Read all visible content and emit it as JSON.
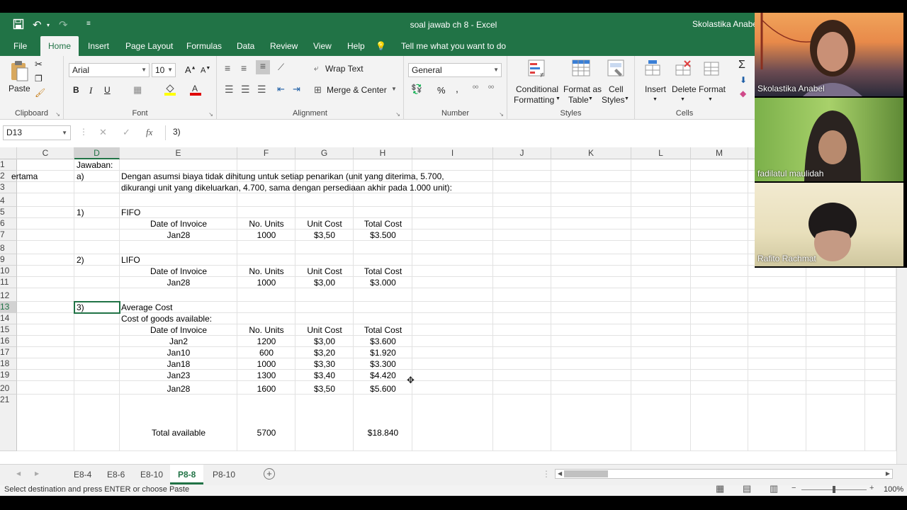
{
  "window": {
    "title": "soal jawab ch 8  -  Excel",
    "account": "Skolastika Anabel"
  },
  "ribbon_tabs": [
    "File",
    "Home",
    "Insert",
    "Page Layout",
    "Formulas",
    "Data",
    "Review",
    "View",
    "Help",
    "Tell me what you want to do"
  ],
  "ribbon": {
    "clipboard": {
      "label": "Clipboard",
      "paste": "Paste"
    },
    "font": {
      "label": "Font",
      "name": "Arial",
      "size": "10",
      "bold": "B",
      "italic": "I",
      "underline": "U"
    },
    "alignment": {
      "label": "Alignment",
      "wrap": "Wrap Text",
      "merge": "Merge & Center"
    },
    "number": {
      "label": "Number",
      "format": "General",
      "percent": "%",
      "comma": ","
    },
    "styles": {
      "label": "Styles",
      "conditional": "Conditional",
      "conditional2": "Formatting",
      "format_as": "Format as",
      "format_as2": "Table",
      "cell": "Cell",
      "cell2": "Styles"
    },
    "cells": {
      "label": "Cells",
      "insert": "Insert",
      "delete": "Delete",
      "format": "Format"
    }
  },
  "formula_bar": {
    "name_box": "D13",
    "content": "3)"
  },
  "columns": [
    "C",
    "D",
    "E",
    "F",
    "G",
    "H",
    "I",
    "J",
    "K",
    "L",
    "M"
  ],
  "rows": [
    {
      "n": "1",
      "D": "Jawaban:"
    },
    {
      "n": "2",
      "C": "ertama",
      "D": "a)",
      "E": "Dengan asumsi biaya tidak dihitung untuk setiap penarikan (unit yang diterima, 5.700,"
    },
    {
      "n": "3",
      "E": "dikurangi unit yang dikeluarkan, 4.700, sama dengan persediaan akhir pada 1.000 unit):"
    },
    {
      "n": "4"
    },
    {
      "n": "5",
      "D": "1)",
      "E": "FIFO"
    },
    {
      "n": "6",
      "Ec": "Date of Invoice",
      "F": "No. Units",
      "G": "Unit Cost",
      "H": "Total Cost"
    },
    {
      "n": "7",
      "Ec": "Jan28",
      "F": "1000",
      "G": "$3,50",
      "H": "$3.500"
    },
    {
      "n": "8"
    },
    {
      "n": "9",
      "D": "2)",
      "E": "LIFO"
    },
    {
      "n": "10",
      "Ec": "Date of Invoice",
      "F": "No. Units",
      "G": "Unit Cost",
      "H": "Total Cost"
    },
    {
      "n": "11",
      "Ec": "Jan28",
      "F": "1000",
      "G": "$3,00",
      "H": "$3.000"
    },
    {
      "n": "12"
    },
    {
      "n": "13",
      "D": "3)",
      "E": "Average Cost"
    },
    {
      "n": "14",
      "E": "Cost of goods available:"
    },
    {
      "n": "15",
      "Ec": "Date of Invoice",
      "F": "No. Units",
      "G": "Unit Cost",
      "H": "Total Cost"
    },
    {
      "n": "16",
      "Ec": "Jan2",
      "F": "1200",
      "G": "$3,00",
      "H": "$3.600"
    },
    {
      "n": "17",
      "Ec": "Jan10",
      "F": "600",
      "G": "$3,20",
      "H": "$1.920"
    },
    {
      "n": "18",
      "Ec": "Jan18",
      "F": "1000",
      "G": "$3,30",
      "H": "$3.300"
    },
    {
      "n": "19",
      "Ec": "Jan23",
      "F": "1300",
      "G": "$3,40",
      "H": "$4.420"
    },
    {
      "n": "20",
      "Ec": "Jan28",
      "F": "1600",
      "G": "$3,50",
      "H": "$5.600"
    },
    {
      "n": "21",
      "Ec": "Total available",
      "F": "5700",
      "H": "$18.840"
    }
  ],
  "sheet_tabs": [
    "E8-4",
    "E8-6",
    "E8-10",
    "P8-8",
    "P8-10"
  ],
  "active_sheet": "P8-8",
  "status": {
    "message": "Select destination and press ENTER or choose Paste",
    "zoom": "100%"
  },
  "participants": [
    "Skolastika Anabel",
    "fadilatul maulidah",
    "Rafito Rachmat"
  ],
  "colors": {
    "excel_green": "#217346"
  }
}
